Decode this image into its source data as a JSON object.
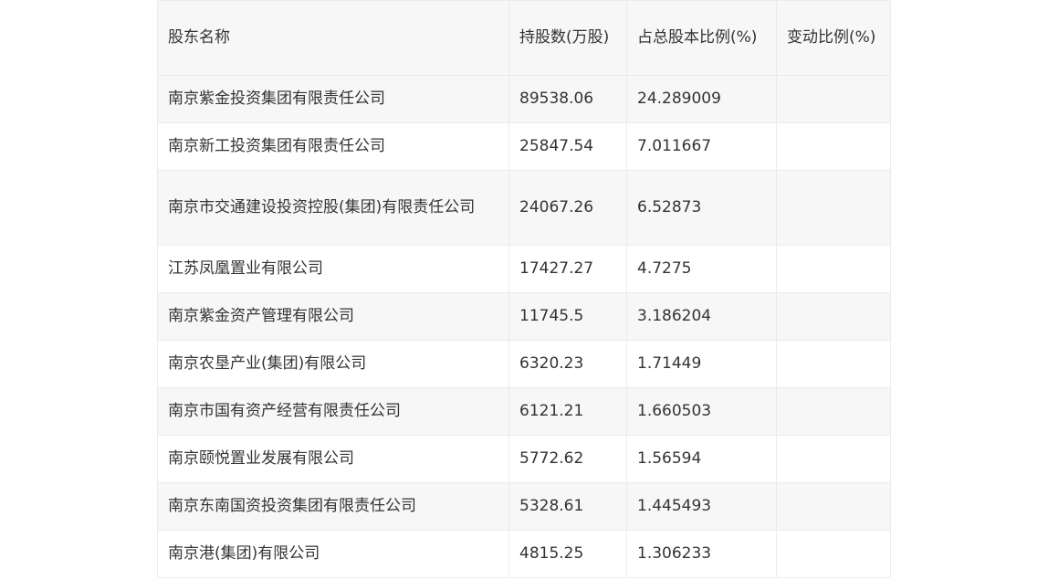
{
  "table": {
    "headers": [
      "股东名称",
      "持股数(万股)",
      "占总股本比例(%)",
      "变动比例(%)"
    ],
    "rows": [
      {
        "name": "南京紫金投资集团有限责任公司",
        "shares": "89538.06",
        "ratio": "24.289009",
        "change": ""
      },
      {
        "name": "南京新工投资集团有限责任公司",
        "shares": "25847.54",
        "ratio": "7.011667",
        "change": ""
      },
      {
        "name": "南京市交通建设投资控股(集团)有限责任公司",
        "shares": "24067.26",
        "ratio": "6.52873",
        "change": ""
      },
      {
        "name": "江苏凤凰置业有限公司",
        "shares": "17427.27",
        "ratio": "4.7275",
        "change": ""
      },
      {
        "name": "南京紫金资产管理有限公司",
        "shares": "11745.5",
        "ratio": "3.186204",
        "change": ""
      },
      {
        "name": "南京农垦产业(集团)有限公司",
        "shares": "6320.23",
        "ratio": "1.71449",
        "change": ""
      },
      {
        "name": "南京市国有资产经营有限责任公司",
        "shares": "6121.21",
        "ratio": "1.660503",
        "change": ""
      },
      {
        "name": "南京颐悦置业发展有限公司",
        "shares": "5772.62",
        "ratio": "1.56594",
        "change": ""
      },
      {
        "name": "南京东南国资投资集团有限责任公司",
        "shares": "5328.61",
        "ratio": "1.445493",
        "change": ""
      },
      {
        "name": "南京港(集团)有限公司",
        "shares": "4815.25",
        "ratio": "1.306233",
        "change": ""
      }
    ]
  }
}
